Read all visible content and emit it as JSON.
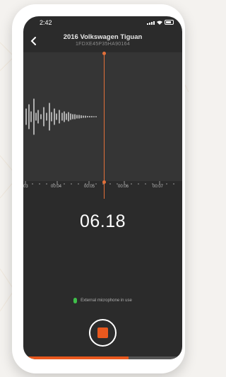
{
  "status_bar": {
    "time": "2:42"
  },
  "header": {
    "title": "2016 Volkswagen Tiguan",
    "vin": "1FDXE45P35HA90164"
  },
  "timeline": {
    "labels": [
      "03",
      "00:04",
      "00:05",
      "00:06",
      "00:07"
    ]
  },
  "recording": {
    "elapsed": "06.18",
    "progress_fraction": 0.66
  },
  "microphone": {
    "status_text": "External microphone in use"
  },
  "colors": {
    "accent": "#e8581e",
    "mic": "#3fbf4a",
    "background": "#2b2b2b"
  },
  "icons": {
    "back": "chevron-left-icon",
    "mic": "microphone-icon",
    "record": "stop-icon"
  }
}
